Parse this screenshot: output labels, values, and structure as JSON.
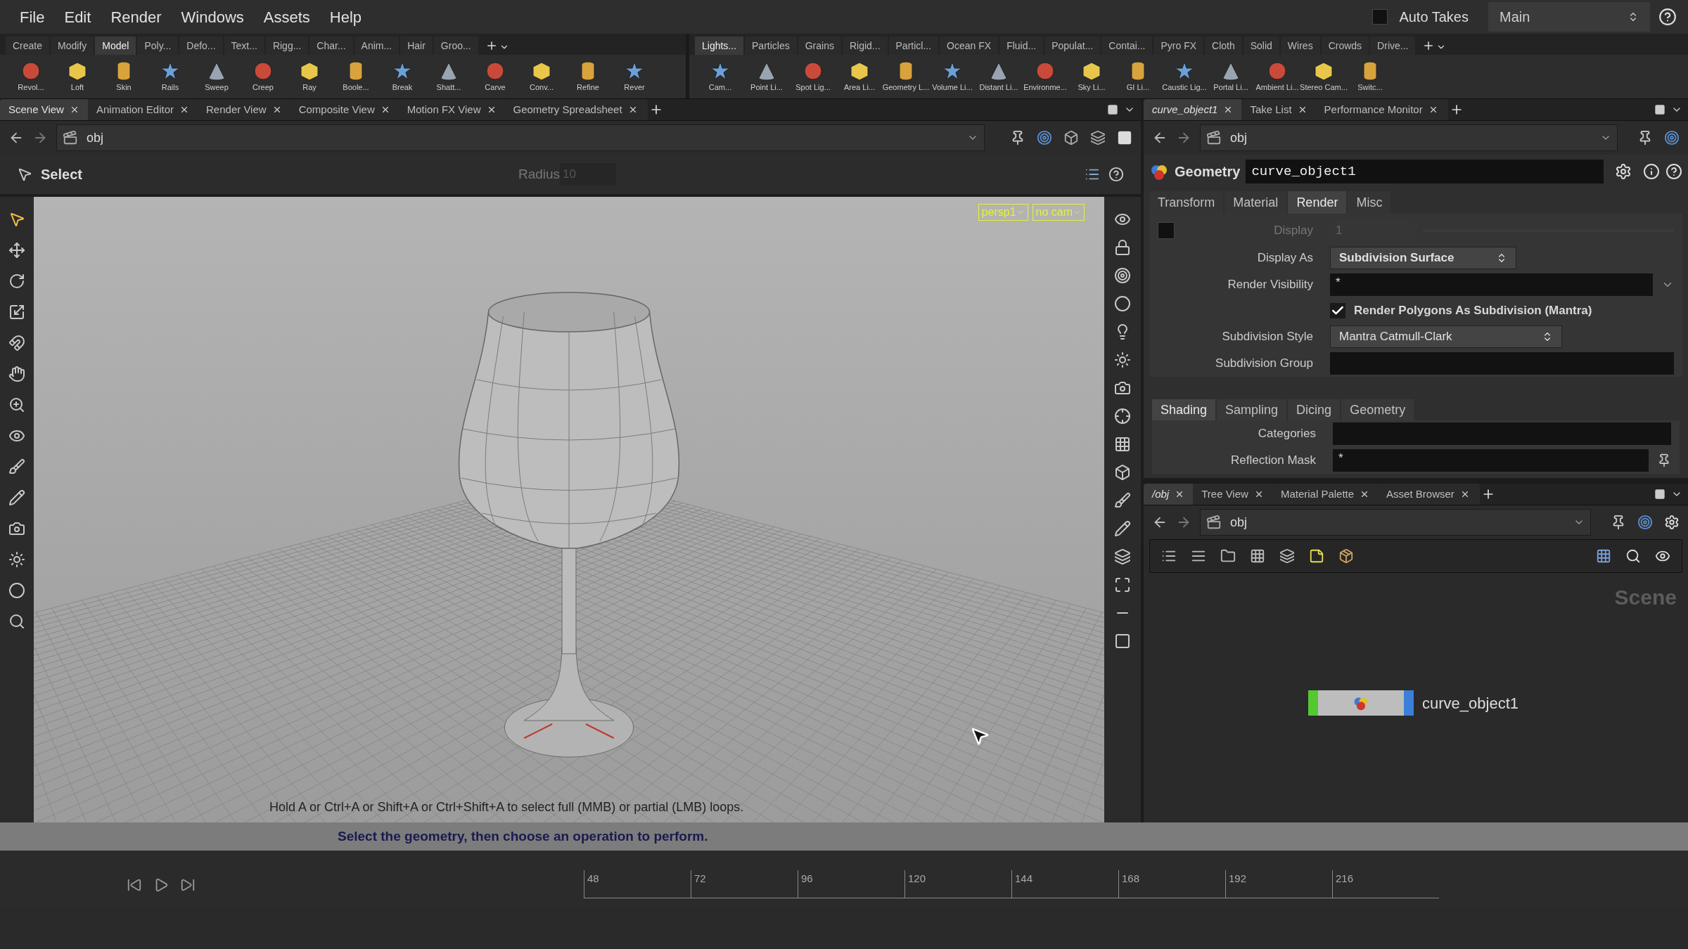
{
  "menu": [
    "File",
    "Edit",
    "Render",
    "Windows",
    "Assets",
    "Help"
  ],
  "auto_takes": {
    "label": "Auto Takes",
    "checked": false
  },
  "desktop": "Main",
  "shelf_left": {
    "tabs": [
      {
        "label": "Create",
        "selected": false
      },
      {
        "label": "Modify",
        "selected": false
      },
      {
        "label": "Model",
        "selected": true
      },
      {
        "label": "Poly...",
        "selected": false
      },
      {
        "label": "Defo...",
        "selected": false
      },
      {
        "label": "Text...",
        "selected": false
      },
      {
        "label": "Rigg...",
        "selected": false
      },
      {
        "label": "Char...",
        "selected": false
      },
      {
        "label": "Anim...",
        "selected": false
      },
      {
        "label": "Hair",
        "selected": false
      },
      {
        "label": "Groo...",
        "selected": false
      }
    ],
    "tools": [
      "Revol...",
      "Loft",
      "Skin",
      "Rails",
      "Sweep",
      "Creep",
      "Ray",
      "Boole...",
      "Break",
      "Shatt...",
      "Carve",
      "Conv...",
      "Refine",
      "Rever"
    ]
  },
  "shelf_right": {
    "tabs": [
      {
        "label": "Lights...",
        "selected": true
      },
      {
        "label": "Particles",
        "selected": false
      },
      {
        "label": "Grains",
        "selected": false
      },
      {
        "label": "Rigid...",
        "selected": false
      },
      {
        "label": "Particl...",
        "selected": false
      },
      {
        "label": "Ocean FX",
        "selected": false
      },
      {
        "label": "Fluid...",
        "selected": false
      },
      {
        "label": "Populat...",
        "selected": false
      },
      {
        "label": "Contai...",
        "selected": false
      },
      {
        "label": "Pyro FX",
        "selected": false
      },
      {
        "label": "Cloth",
        "selected": false
      },
      {
        "label": "Solid",
        "selected": false
      },
      {
        "label": "Wires",
        "selected": false
      },
      {
        "label": "Crowds",
        "selected": false
      },
      {
        "label": "Drive...",
        "selected": false
      }
    ],
    "tools": [
      "Cam...",
      "Point Li...",
      "Spot Lig...",
      "Area Li...",
      "Geometry L...",
      "Volume Li...",
      "Distant Li...",
      "Environme...",
      "Sky Li...",
      "GI Li...",
      "Caustic Lig...",
      "Portal Li...",
      "Ambient Li...",
      "Stereo Cam...",
      "Switc..."
    ]
  },
  "scene_pane": {
    "tabs": [
      {
        "label": "Scene View",
        "selected": true
      },
      {
        "label": "Animation Editor",
        "selected": false
      },
      {
        "label": "Render View",
        "selected": false
      },
      {
        "label": "Composite View",
        "selected": false
      },
      {
        "label": "Motion FX View",
        "selected": false
      },
      {
        "label": "Geometry Spreadsheet",
        "selected": false
      }
    ],
    "path": "obj",
    "operation": "Select",
    "radius_label": "Radius",
    "radius_value": "10",
    "camera_menus": [
      "persp1",
      "no cam"
    ],
    "hint": "Hold A or Ctrl+A or Shift+A or Ctrl+Shift+A to select full (MMB) or partial (LMB) loops.",
    "status": "Select the geometry, then choose an operation to perform."
  },
  "parameter_pane": {
    "tabs": [
      {
        "label": "curve_object1",
        "selected": true
      },
      {
        "label": "Take List",
        "selected": false
      },
      {
        "label": "Performance Monitor",
        "selected": false
      }
    ],
    "path": "obj",
    "node_type": "Geometry",
    "node_name": "curve_object1",
    "tabs_param": [
      {
        "label": "Transform",
        "selected": false
      },
      {
        "label": "Material",
        "selected": false
      },
      {
        "label": "Render",
        "selected": true
      },
      {
        "label": "Misc",
        "selected": false
      }
    ],
    "rows": [
      {
        "kind": "number",
        "label": "Display",
        "value": "1",
        "checked": false,
        "disabled": true
      },
      {
        "kind": "menu",
        "label": "Display As",
        "value": "Subdivision Surface",
        "bold": true
      },
      {
        "kind": "text",
        "label": "Render Visibility",
        "value": "*",
        "dropdown": true
      },
      {
        "kind": "toggle",
        "label": "Render Polygons As Subdivision (Mantra)",
        "checked": true
      },
      {
        "kind": "menu",
        "label": "Subdivision Style",
        "value": "Mantra Catmull-Clark",
        "bold": false
      },
      {
        "kind": "text",
        "label": "Subdivision Group",
        "dropdown": false
      }
    ],
    "subtabs": [
      {
        "label": "Shading",
        "selected": true
      },
      {
        "label": "Sampling",
        "selected": false
      },
      {
        "label": "Dicing",
        "selected": false
      },
      {
        "label": "Geometry",
        "selected": false
      }
    ],
    "subrows": [
      {
        "kind": "text",
        "label": "Categories",
        "dropdown": false
      },
      {
        "kind": "text",
        "label": "Reflection Mask",
        "value": "*",
        "button": true
      }
    ]
  },
  "network_pane": {
    "tabs": [
      {
        "label": "/obj",
        "selected": true
      },
      {
        "label": "Tree View",
        "selected": false
      },
      {
        "label": "Material Palette",
        "selected": false
      },
      {
        "label": "Asset Browser",
        "selected": false
      }
    ],
    "path": "obj",
    "context_label": "Scene",
    "node": {
      "name": "curve_object1"
    }
  },
  "timeline": {
    "ticks": [
      "48",
      "72",
      "96",
      "120",
      "144",
      "168",
      "192",
      "216"
    ]
  }
}
